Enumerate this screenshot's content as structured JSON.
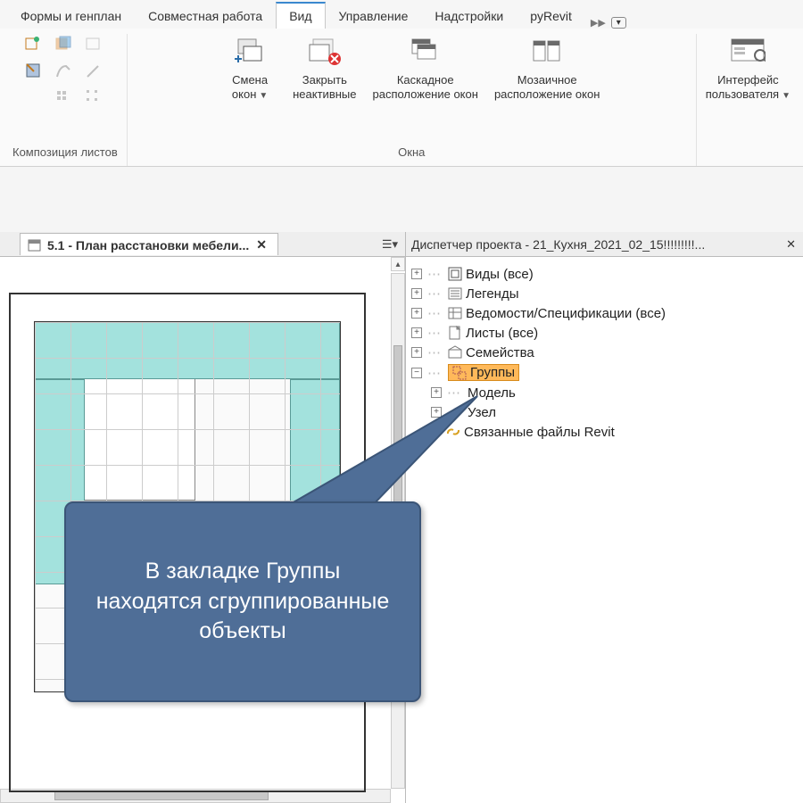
{
  "tabs": {
    "forms": "Формы и генплан",
    "collab": "Совместная работа",
    "view": "Вид",
    "manage": "Управление",
    "addins": "Надстройки",
    "pyrevit": "pyRevit"
  },
  "ribbon_groups": {
    "sheets": "Композиция листов",
    "windows": "Окна"
  },
  "buttons": {
    "switch_windows_l1": "Смена",
    "switch_windows_l2": "окон",
    "close_inactive_l1": "Закрыть",
    "close_inactive_l2": "неактивные",
    "cascade_l1": "Каскадное",
    "cascade_l2": "расположение окон",
    "tile_l1": "Мозаичное",
    "tile_l2": "расположение окон",
    "ui_l1": "Интерфейс",
    "ui_l2": "пользователя"
  },
  "view_tab": {
    "title": "5.1 - План расстановки мебели..."
  },
  "browser": {
    "title": "Диспетчер проекта - 21_Кухня_2021_02_15!!!!!!!!!...",
    "items": {
      "views": "Виды (все)",
      "legends": "Легенды",
      "schedules": "Ведомости/Спецификации (все)",
      "sheets": "Листы (все)",
      "families": "Семейства",
      "groups": "Группы",
      "model": "Модель",
      "detail": "Узел",
      "links": "Связанные файлы Revit"
    }
  },
  "callout_text": "В закладке Группы находятся сгруппированные объекты"
}
